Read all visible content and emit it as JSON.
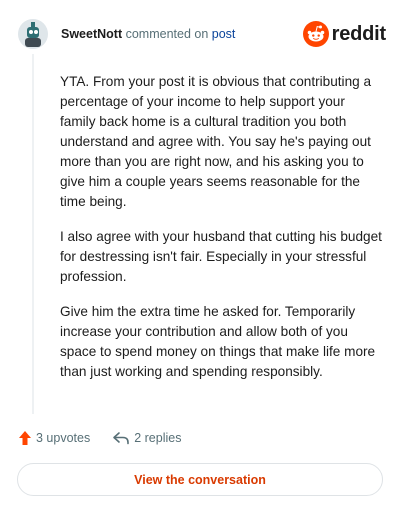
{
  "header": {
    "username": "SweetNott",
    "action_text": "commented on",
    "post_link": "post",
    "brand_text": "reddit",
    "avatar_icon": "snoo-avatar-icon"
  },
  "comment": {
    "paragraphs": [
      "YTA. From your post it is obvious that contributing a percentage of your income to help support your family back home is a cultural tradition you both understand and agree with. You say he's paying out more than you are right now, and his asking you to give him a couple years seems reasonable for the time being.",
      "I also agree with your husband that cutting his budget for destressing isn't fair. Especially in your stressful profession.",
      "Give him the extra time he asked for. Temporarily increase your contribution and allow both of you space to spend money on things that make life more than just working and spending responsibly."
    ]
  },
  "actions": {
    "upvotes_label": "3 upvotes",
    "replies_label": "2 replies"
  },
  "footer": {
    "button_label": "View the conversation"
  },
  "colors": {
    "brand_orange": "#ff4500",
    "button_text": "#d93a00",
    "link_blue": "#0a449b",
    "muted": "#576f76"
  }
}
